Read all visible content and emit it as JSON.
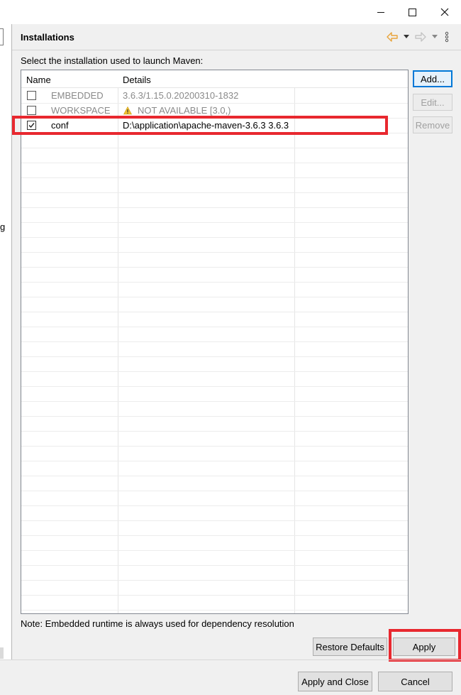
{
  "window": {
    "controls": [
      "minimize",
      "maximize",
      "close"
    ]
  },
  "left_panel": {
    "fragment_text": "g"
  },
  "header": {
    "title": "Installations",
    "icons": [
      "back-arrow-icon",
      "dropdown-icon",
      "forward-arrow-icon",
      "dropdown-icon",
      "view-menu-icon"
    ],
    "back_color": "#e8a33a"
  },
  "instruction": "Select the installation used to launch Maven:",
  "table": {
    "columns": [
      "Name",
      "Details"
    ],
    "rows": [
      {
        "checked": false,
        "enabled": false,
        "name": "EMBEDDED",
        "details": "3.6.3/1.15.0.20200310-1832",
        "warning": false
      },
      {
        "checked": false,
        "enabled": false,
        "name": "WORKSPACE",
        "details": "NOT AVAILABLE [3.0,)",
        "warning": true
      },
      {
        "checked": true,
        "enabled": true,
        "name": "conf",
        "details": "D:\\application\\apache-maven-3.6.3 3.6.3",
        "warning": false
      }
    ]
  },
  "side_buttons": {
    "add": "Add...",
    "edit": "Edit...",
    "remove": "Remove"
  },
  "note": "Note: Embedded runtime is always used for dependency resolution",
  "buttons": {
    "restore_defaults": "Restore Defaults",
    "apply": "Apply",
    "apply_and_close": "Apply and Close",
    "cancel": "Cancel"
  },
  "colors": {
    "highlight": "#e8282f",
    "primary_border": "#0078d7",
    "warning": "#f2c230"
  }
}
